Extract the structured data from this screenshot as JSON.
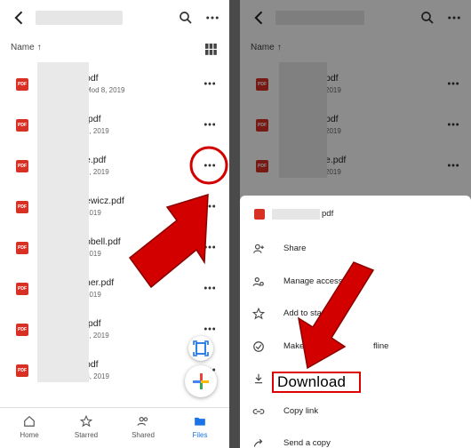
{
  "left": {
    "sort_label": "Name",
    "sort_arrow": "↑",
    "files": [
      {
        "name_suffix": "odf",
        "date": "Mod 8, 2019"
      },
      {
        "name_suffix": ".pdf",
        "date": "8, 2019"
      },
      {
        "name_suffix": "e.pdf",
        "date": "8, 2019"
      },
      {
        "name_suffix": "ewicz.pdf",
        "date": "2019"
      },
      {
        "name_suffix": "obell.pdf",
        "date": "2019"
      },
      {
        "name_suffix": "ner.pdf",
        "date": "2019"
      },
      {
        "name_suffix": ".pdf",
        "date": "8, 2019"
      },
      {
        "name_suffix": "pdf",
        "date": "Modified May 28, 2019"
      }
    ],
    "nav": [
      {
        "label": "Home",
        "icon": "home-icon"
      },
      {
        "label": "Starred",
        "icon": "star-icon"
      },
      {
        "label": "Shared",
        "icon": "people-icon"
      },
      {
        "label": "Files",
        "icon": "folder-icon",
        "active": true
      }
    ]
  },
  "right": {
    "sort_label": "Name",
    "sort_arrow": "↑",
    "files": [
      {
        "name_suffix": "pdf",
        "date": "2019"
      },
      {
        "name_suffix": "pdf",
        "date": "2019"
      },
      {
        "name_suffix": "e.pdf",
        "date": "2019"
      }
    ],
    "sheet": {
      "header_suffix": "pdf",
      "items": [
        {
          "label": "Share",
          "icon": "add-person-icon"
        },
        {
          "label": "Manage access",
          "icon": "manage-people-icon"
        },
        {
          "label": "Add to starred",
          "icon": "star-outline-icon"
        },
        {
          "label": "Make ava",
          "suffix": "fline",
          "icon": "offline-check-icon"
        },
        {
          "label": "Download",
          "icon": "download-icon"
        },
        {
          "label": "Copy link",
          "icon": "link-icon"
        },
        {
          "label": "Send a copy",
          "icon": "send-icon"
        }
      ]
    }
  },
  "colors": {
    "accent": "#1a73e8",
    "pdf_red": "#d93025",
    "annotation_red": "#d30000"
  }
}
